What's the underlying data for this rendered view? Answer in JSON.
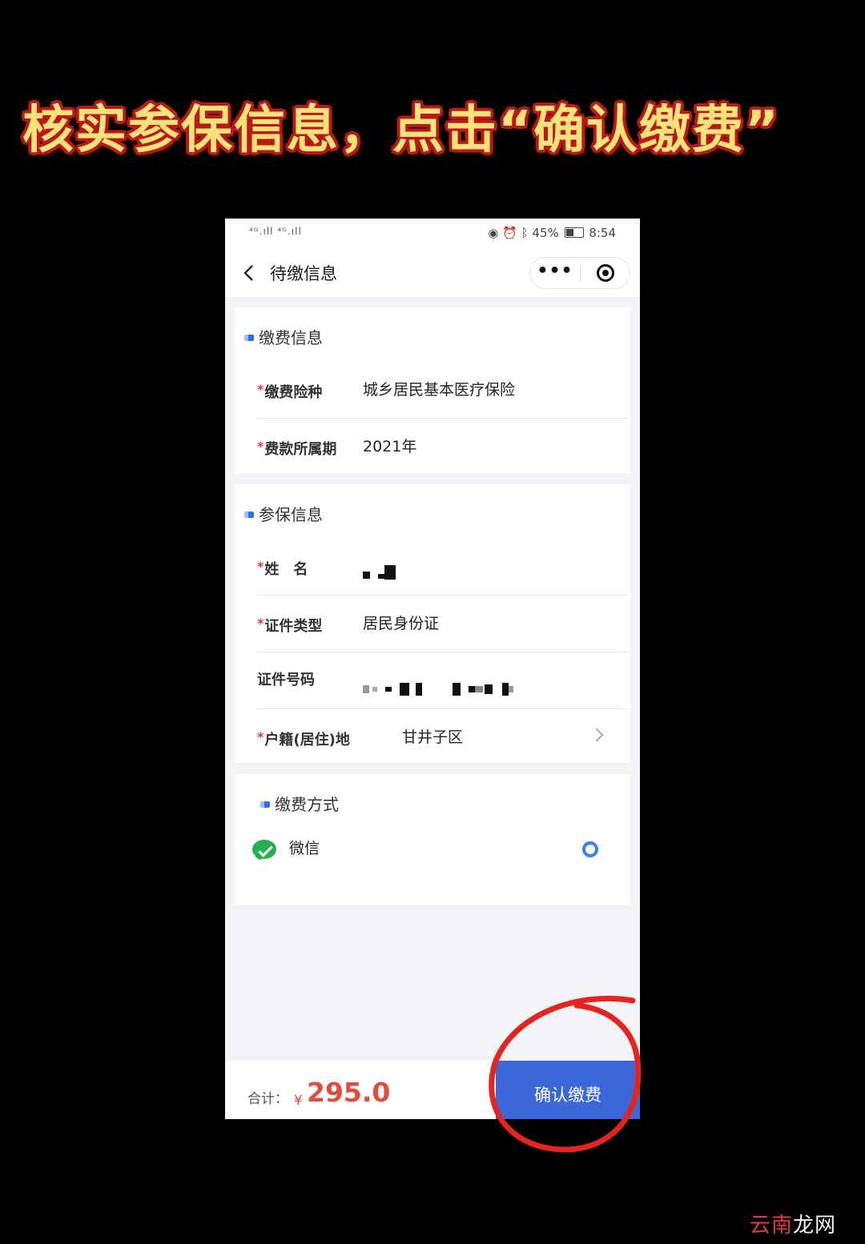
{
  "banner": {
    "text": "核实参保信息，点击“确认缴费”"
  },
  "status_bar": {
    "network": "⁴ᴳ.ıll ⁴ᴳ.ıll",
    "battery": "45%",
    "time": "8:54"
  },
  "navbar": {
    "title": "待缴信息"
  },
  "payment_info": {
    "title": "缴费信息",
    "insurance_type_label": "缴费险种",
    "insurance_type_value": "城乡居民基本医疗保险",
    "period_label": "费款所属期",
    "period_value": "2021年"
  },
  "insured_info": {
    "title": "参保信息",
    "name_label": "姓　名",
    "id_type_label": "证件类型",
    "id_type_value": "居民身份证",
    "id_number_label": "证件号码",
    "residence_label": "户籍(居住)地",
    "residence_value": "甘井子区"
  },
  "payment_method": {
    "title": "缴费方式",
    "option_label": "微信"
  },
  "footer": {
    "total_label": "合计：",
    "currency": "¥",
    "amount": "295.0",
    "confirm_label": "确认缴费"
  },
  "watermark": {
    "part1": "云南",
    "part2": "龙网"
  },
  "colors": {
    "accent": "#3c67d9",
    "price": "#e54b3c",
    "required": "#e23a3a",
    "wechat": "#22b14c",
    "annotation": "#e52420"
  }
}
